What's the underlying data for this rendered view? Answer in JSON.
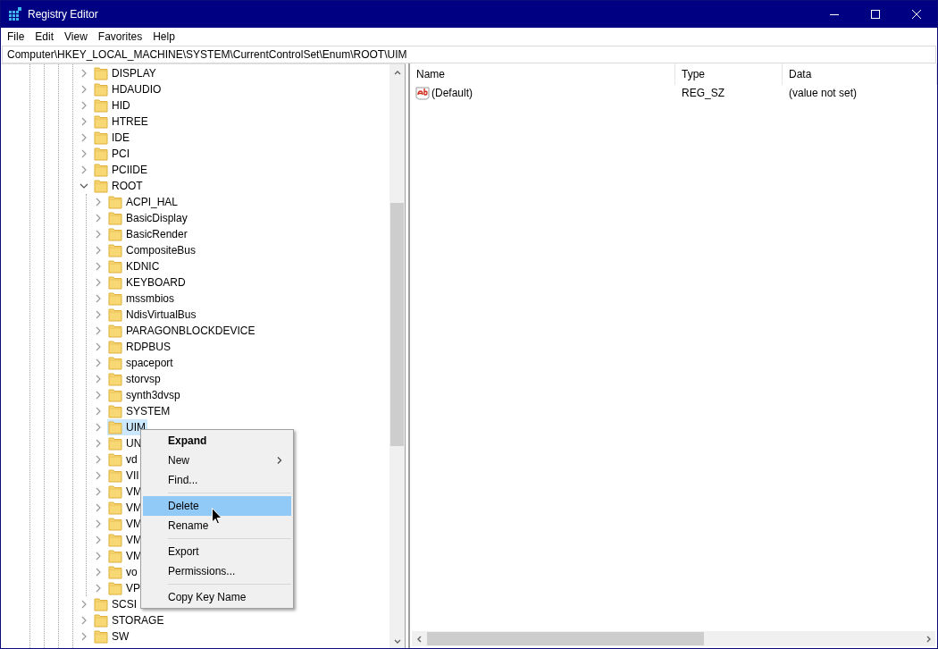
{
  "window": {
    "title": "Registry Editor"
  },
  "menu_bar": [
    "File",
    "Edit",
    "View",
    "Favorites",
    "Help"
  ],
  "address": "Computer\\HKEY_LOCAL_MACHINE\\SYSTEM\\CurrentControlSet\\Enum\\ROOT\\UIM",
  "tree": [
    {
      "label": "DISPLAY",
      "expanded": false,
      "selected": false
    },
    {
      "label": "HDAUDIO",
      "expanded": false,
      "selected": false
    },
    {
      "label": "HID",
      "expanded": false,
      "selected": false
    },
    {
      "label": "HTREE",
      "expanded": false,
      "selected": false
    },
    {
      "label": "IDE",
      "expanded": false,
      "selected": false
    },
    {
      "label": "PCI",
      "expanded": false,
      "selected": false
    },
    {
      "label": "PCIIDE",
      "expanded": false,
      "selected": false
    },
    {
      "label": "ROOT",
      "expanded": true,
      "selected": false,
      "children": [
        {
          "label": "ACPI_HAL",
          "expanded": false,
          "selected": false
        },
        {
          "label": "BasicDisplay",
          "expanded": false,
          "selected": false
        },
        {
          "label": "BasicRender",
          "expanded": false,
          "selected": false
        },
        {
          "label": "CompositeBus",
          "expanded": false,
          "selected": false
        },
        {
          "label": "KDNIC",
          "expanded": false,
          "selected": false
        },
        {
          "label": "KEYBOARD",
          "expanded": false,
          "selected": false
        },
        {
          "label": "mssmbios",
          "expanded": false,
          "selected": false
        },
        {
          "label": "NdisVirtualBus",
          "expanded": false,
          "selected": false
        },
        {
          "label": "PARAGONBLOCKDEVICE",
          "expanded": false,
          "selected": false
        },
        {
          "label": "RDPBUS",
          "expanded": false,
          "selected": false
        },
        {
          "label": "spaceport",
          "expanded": false,
          "selected": false
        },
        {
          "label": "storvsp",
          "expanded": false,
          "selected": false
        },
        {
          "label": "synth3dvsp",
          "expanded": false,
          "selected": false
        },
        {
          "label": "SYSTEM",
          "expanded": false,
          "selected": false
        },
        {
          "label": "UIM",
          "expanded": false,
          "selected": true
        },
        {
          "label": "UN",
          "expanded": false,
          "selected": false
        },
        {
          "label": "vd",
          "expanded": false,
          "selected": false
        },
        {
          "label": "VII",
          "expanded": false,
          "selected": false
        },
        {
          "label": "VM",
          "expanded": false,
          "selected": false
        },
        {
          "label": "VM",
          "expanded": false,
          "selected": false
        },
        {
          "label": "VM",
          "expanded": false,
          "selected": false
        },
        {
          "label": "VM",
          "expanded": false,
          "selected": false
        },
        {
          "label": "VM",
          "expanded": false,
          "selected": false
        },
        {
          "label": "vo",
          "expanded": false,
          "selected": false
        },
        {
          "label": "VP",
          "expanded": false,
          "selected": false
        }
      ]
    },
    {
      "label": "SCSI",
      "expanded": false,
      "selected": false
    },
    {
      "label": "STORAGE",
      "expanded": false,
      "selected": false
    },
    {
      "label": "SW",
      "expanded": false,
      "selected": false
    }
  ],
  "values": {
    "columns": [
      "Name",
      "Type",
      "Data"
    ],
    "rows": [
      {
        "name": "(Default)",
        "type": "REG_SZ",
        "data": "(value not set)"
      }
    ]
  },
  "context_menu": [
    {
      "kind": "item",
      "label": "Expand",
      "bold": true,
      "submenu": false,
      "highlighted": false
    },
    {
      "kind": "item",
      "label": "New",
      "bold": false,
      "submenu": true,
      "highlighted": false
    },
    {
      "kind": "item",
      "label": "Find...",
      "bold": false,
      "submenu": false,
      "highlighted": false
    },
    {
      "kind": "separator"
    },
    {
      "kind": "item",
      "label": "Delete",
      "bold": false,
      "submenu": false,
      "highlighted": true
    },
    {
      "kind": "item",
      "label": "Rename",
      "bold": false,
      "submenu": false,
      "highlighted": false
    },
    {
      "kind": "separator"
    },
    {
      "kind": "item",
      "label": "Export",
      "bold": false,
      "submenu": false,
      "highlighted": false
    },
    {
      "kind": "item",
      "label": "Permissions...",
      "bold": false,
      "submenu": false,
      "highlighted": false
    },
    {
      "kind": "separator"
    },
    {
      "kind": "item",
      "label": "Copy Key Name",
      "bold": false,
      "submenu": false,
      "highlighted": false
    }
  ]
}
